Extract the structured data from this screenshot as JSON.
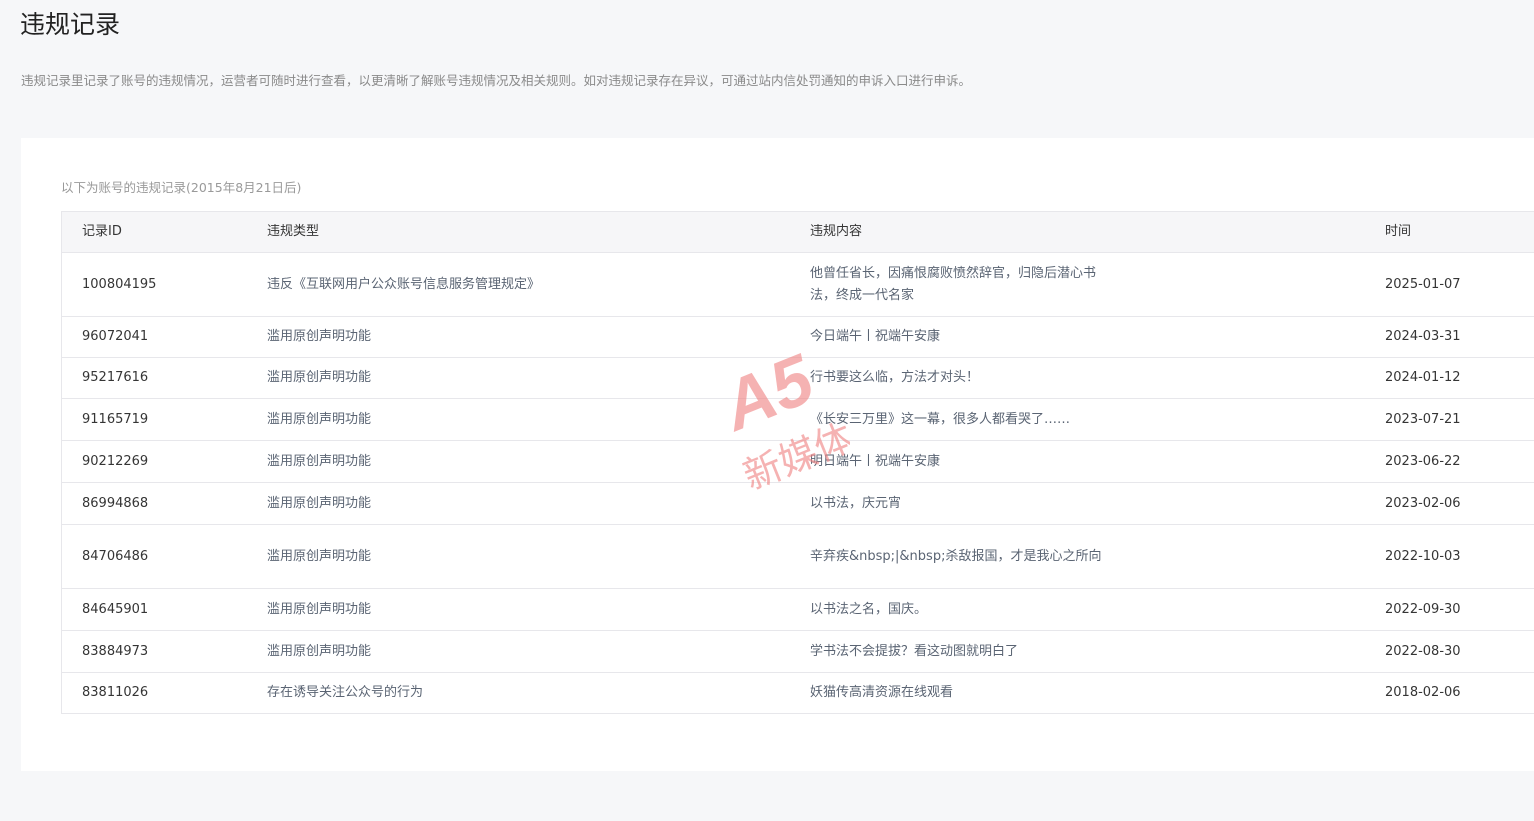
{
  "page": {
    "title": "违规记录",
    "description": "违规记录里记录了账号的违规情况，运营者可随时进行查看，以更清晰了解账号违规情况及相关规则。如对违规记录存在异议，可通过站内信处罚通知的申诉入口进行申诉。"
  },
  "card": {
    "subtitle": "以下为账号的违规记录(2015年8月21日后)"
  },
  "table": {
    "headers": {
      "id": "记录ID",
      "type": "违规类型",
      "content": "违规内容",
      "time": "时间"
    },
    "rows": [
      {
        "id": "100804195",
        "type": "违反《互联网用户公众账号信息服务管理规定》",
        "content": "他曾任省长，因痛恨腐败愤然辞官，归隐后潜心书法，终成一代名家",
        "time": "2025-01-07"
      },
      {
        "id": "96072041",
        "type": "滥用原创声明功能",
        "content": "今日端午丨祝端午安康",
        "time": "2024-03-31"
      },
      {
        "id": "95217616",
        "type": "滥用原创声明功能",
        "content": "行书要这么临，方法才对头！",
        "time": "2024-01-12"
      },
      {
        "id": "91165719",
        "type": "滥用原创声明功能",
        "content": "《长安三万里》这一幕，很多人都看哭了……",
        "time": "2023-07-21"
      },
      {
        "id": "90212269",
        "type": "滥用原创声明功能",
        "content": "明日端午丨祝端午安康",
        "time": "2023-06-22"
      },
      {
        "id": "86994868",
        "type": "滥用原创声明功能",
        "content": "以书法，庆元宵",
        "time": "2023-02-06"
      },
      {
        "id": "84706486",
        "type": "滥用原创声明功能",
        "content": "辛弃疾&nbsp;|&nbsp;杀敌报国，才是我心之所向",
        "time": "2022-10-03"
      },
      {
        "id": "84645901",
        "type": "滥用原创声明功能",
        "content": "以书法之名，国庆。",
        "time": "2022-09-30"
      },
      {
        "id": "83884973",
        "type": "滥用原创声明功能",
        "content": "学书法不会提拔？看这动图就明白了",
        "time": "2022-08-30"
      },
      {
        "id": "83811026",
        "type": "存在诱导关注公众号的行为",
        "content": "妖猫传高清资源在线观看",
        "time": "2018-02-06"
      }
    ]
  },
  "watermark": {
    "logo_text": "A5",
    "text": "新媒体",
    "color": "#f08080"
  }
}
